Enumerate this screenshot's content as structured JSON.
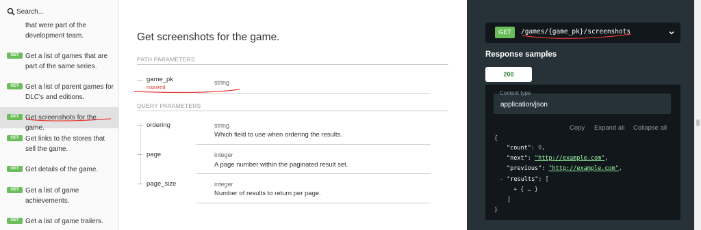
{
  "sidebar": {
    "search_placeholder": "Search...",
    "items": [
      {
        "method": "",
        "label": "that were part of the development team."
      },
      {
        "method": "GET",
        "label": "Get a list of games that are part of the same series."
      },
      {
        "method": "GET",
        "label": "Get a list of parent games for DLC's and editions."
      },
      {
        "method": "GET",
        "label": "Get screenshots for the game."
      },
      {
        "method": "GET",
        "label": "Get links to the stores that sell the game."
      },
      {
        "method": "GET",
        "label": "Get details of the game."
      },
      {
        "method": "GET",
        "label": "Get a list of game achievements."
      },
      {
        "method": "GET",
        "label": "Get a list of game trailers."
      }
    ]
  },
  "main": {
    "title": "Get screenshots for the game.",
    "path_section": "PATH PARAMETERS",
    "query_section": "QUERY PARAMETERS",
    "path_params": [
      {
        "name": "game_pk",
        "required": "required",
        "type": "string",
        "description": ""
      }
    ],
    "query_params": [
      {
        "name": "ordering",
        "type": "string",
        "description": "Which field to use when ordering the results."
      },
      {
        "name": "page",
        "type": "integer",
        "description": "A page number within the paginated result set."
      },
      {
        "name": "page_size",
        "type": "integer",
        "description": "Number of results to return per page."
      }
    ]
  },
  "right": {
    "method": "GET",
    "path": "/games/{game_pk}/screenshots",
    "response_title": "Response samples",
    "status_code": "200",
    "content_type_label": "Content type",
    "content_type": "application/json",
    "copy": "Copy",
    "expand_all": "Expand all",
    "collapse_all": "Collapse all",
    "json": {
      "open": "{",
      "count_key": "\"count\"",
      "count_val": "0",
      "next_key": "\"next\"",
      "next_val": "\"http://example.com\"",
      "prev_key": "\"previous\"",
      "prev_val": "\"http://example.com\"",
      "results_key": "\"results\"",
      "results_toggle": "-",
      "results_open": "[",
      "item_toggle": "+",
      "item_body": "{ … }",
      "results_close": "]",
      "close": "}"
    }
  },
  "colors": {
    "get_badge": "#6bbd5b",
    "annotation": "#e53935",
    "right_panel": "#263238",
    "code_bg": "#11171a"
  }
}
